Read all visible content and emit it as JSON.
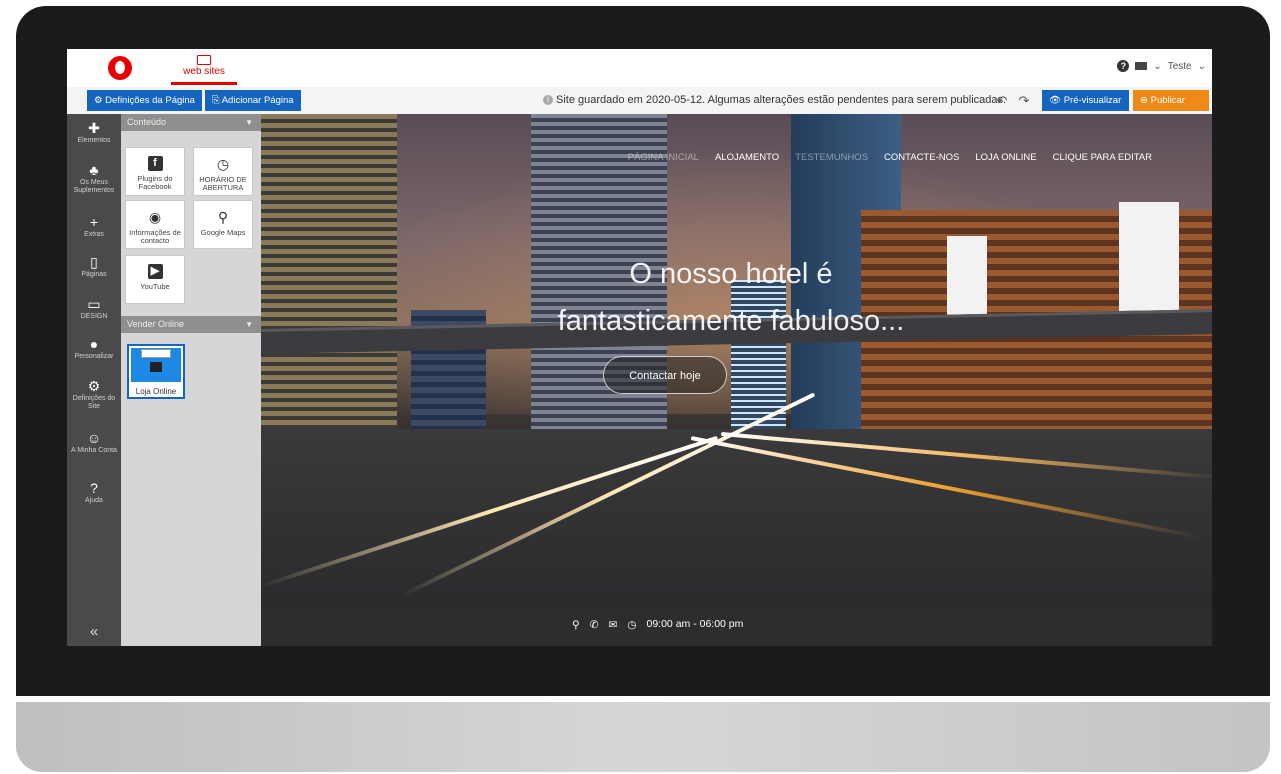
{
  "topbar": {
    "brand_icon": "vodafone-logo",
    "tab_label": "web sites",
    "user_label": "Teste"
  },
  "toolbar": {
    "page_settings": "Definições da Página",
    "add_page": "Adicionar Página",
    "status": "Site guardado em 2020-05-12. Algumas alterações estão pendentes para serem publicadas.",
    "preview": "Pré-visualizar",
    "publish": "Publicar"
  },
  "rail": [
    {
      "icon": "grid-icon",
      "label": "Elementos"
    },
    {
      "icon": "puzzle-icon",
      "label": "Os Meus Suplementos"
    },
    {
      "icon": "plus-icon",
      "label": "Extras"
    },
    {
      "icon": "page-icon",
      "label": "Páginas"
    },
    {
      "icon": "monitor-icon",
      "label": "DESIGN"
    },
    {
      "icon": "drop-icon",
      "label": "Personalizar"
    },
    {
      "icon": "gear-icon",
      "label": "Definições do Site"
    },
    {
      "icon": "account-icon",
      "label": "A Minha Conta"
    },
    {
      "icon": "question-icon",
      "label": "Ajuda"
    }
  ],
  "panel": {
    "section1": "Conteúdo",
    "tiles": [
      {
        "icon": "facebook-icon",
        "label": "Plugins do Facebook"
      },
      {
        "icon": "clock-icon",
        "label": "HORÁRIO DE ABERTURA"
      },
      {
        "icon": "globe-icon",
        "label": "Informações de contacto"
      },
      {
        "icon": "map-pin-icon",
        "label": "Google Maps"
      },
      {
        "icon": "youtube-icon",
        "label": "YouTube"
      }
    ],
    "section2": "Vender Online",
    "shop_label": "Loja Online"
  },
  "hero": {
    "nav": [
      "PÁGINA INICIAL",
      "ALOJAMENTO",
      "TESTEMUNHOS",
      "CONTACTE-NOS",
      "LOJA ONLINE",
      "CLIQUE PARA EDITAR"
    ],
    "title_line1": "O nosso hotel é",
    "title_line2": "fantasticamente fabuloso...",
    "cta": "Contactar hoje"
  },
  "footer": {
    "hours": "09:00 am - 06:00 pm"
  }
}
